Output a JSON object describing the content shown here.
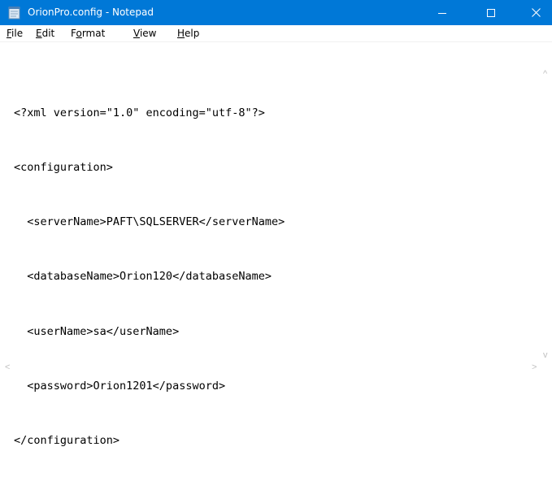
{
  "window": {
    "title": "OrionPro.config - Notepad",
    "title_bar_color": "#0078d7",
    "icons": {
      "app": "notepad-icon",
      "minimize": "minimize-icon",
      "maximize": "maximize-icon",
      "close": "close-icon"
    }
  },
  "menu": {
    "file": {
      "label_first": "F",
      "label_rest": "ile"
    },
    "edit": {
      "label_first": "E",
      "label_rest": "dit"
    },
    "format": {
      "label_before": "F",
      "label_underlined": "o",
      "label_after": "rmat"
    },
    "view": {
      "label_first": "V",
      "label_rest": "iew"
    },
    "help": {
      "label_first": "H",
      "label_rest": "elp"
    }
  },
  "document": {
    "lines": [
      "<?xml version=\"1.0\" encoding=\"utf-8\"?>",
      "<configuration>",
      "  <serverName>PAFT\\SQLSERVER</serverName>",
      "  <databaseName>Orion120</databaseName>",
      "  <userName>sa</userName>",
      "  <password>Orion1201</password>",
      "</configuration>"
    ]
  },
  "scrollbars": {
    "up_arrow": "^",
    "down_arrow": "v",
    "left_arrow": "<",
    "right_arrow": ">"
  }
}
